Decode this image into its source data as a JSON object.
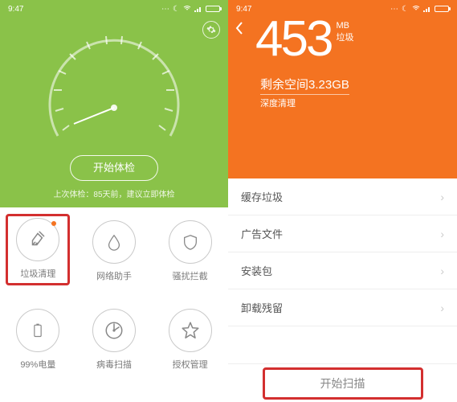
{
  "statusbar": {
    "time": "9:47"
  },
  "left": {
    "start_button": "开始体检",
    "last_check": "上次体检：85天前，建议立即体检",
    "tools": {
      "trash": "垃圾清理",
      "network": "网络助手",
      "block": "骚扰拦截",
      "battery": "99%电量",
      "virus": "病毒扫描",
      "permission": "授权管理"
    }
  },
  "right": {
    "number": "453",
    "unit": "MB",
    "unit_sub": "垃圾",
    "space_prefix": "剩余空间",
    "space_value": "3.23GB",
    "deep_clean": "深度清理",
    "rows": {
      "cache": "缓存垃圾",
      "ads": "广告文件",
      "apk": "安装包",
      "residual": "卸载残留"
    },
    "scan_button": "开始扫描"
  }
}
